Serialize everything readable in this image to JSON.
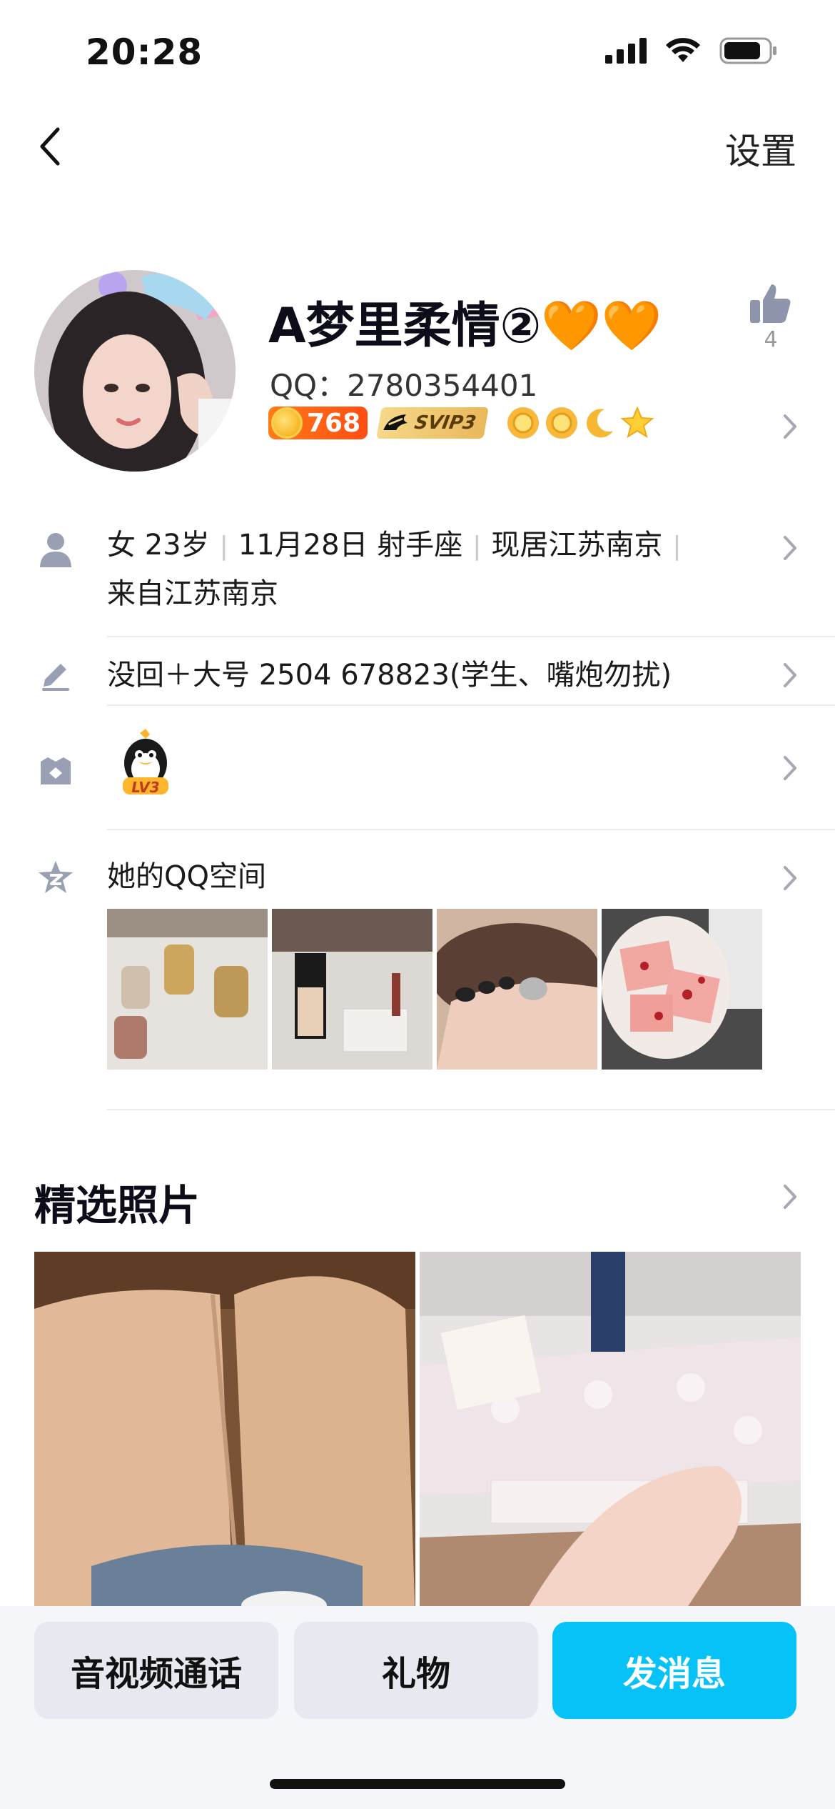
{
  "status": {
    "time": "20:28"
  },
  "nav": {
    "settings_label": "设置"
  },
  "profile": {
    "name": "A梦里柔情②🧡🧡",
    "qq_id": "QQ：2780354401",
    "coin_count": "768",
    "svip_label": "SVIP3",
    "like_count": "4"
  },
  "info": {
    "gender_age": "女 23岁",
    "birthday": "11月28日 射手座",
    "location": "现居江苏南京",
    "hometown": "来自江苏南京",
    "signature": "没回＋大号 2504  678823(学生、嘴炮勿扰)",
    "level_badge": "LV3"
  },
  "qzone": {
    "label": "她的QQ空间"
  },
  "featured": {
    "title": "精选照片"
  },
  "actions": {
    "call_label": "音视频通话",
    "gift_label": "礼物",
    "message_label": "发消息"
  },
  "colors": {
    "accent": "#06c2f7",
    "coin": "#ff5a14",
    "svip": "#e9b85a",
    "icon_gray": "#9aa0b4"
  }
}
